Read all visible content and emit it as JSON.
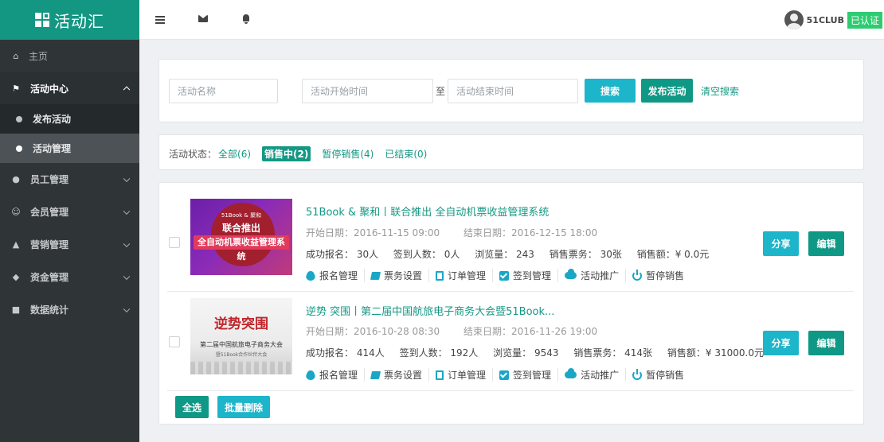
{
  "logo": {
    "text": "活动汇"
  },
  "sidebar": {
    "home": "主页",
    "activity_center": "活动中心",
    "sub": [
      "发布活动",
      "活动管理"
    ],
    "items": [
      "员工管理",
      "会员管理",
      "营销管理",
      "资金管理",
      "数据统计"
    ]
  },
  "header": {
    "username": "51CLUB",
    "verified": "已认证"
  },
  "search": {
    "name_placeholder": "活动名称",
    "start_placeholder": "活动开始时间",
    "to": "至",
    "end_placeholder": "活动结束时间",
    "search_btn": "搜索",
    "publish_btn": "发布活动",
    "clear": "清空搜索"
  },
  "status": {
    "label": "活动状态：",
    "options": [
      "全部(6)",
      "销售中(2)",
      "暂停销售(4)",
      "已结束(0)"
    ]
  },
  "events": [
    {
      "title": "51Book & 聚和丨联合推出 全自动机票收益管理系统",
      "start": "开始日期：2016-11-15 09:00",
      "end": "结束日期：2016-12-15 18:00",
      "signups": "成功报名： 30人",
      "checkins": "签到人数： 0人",
      "views": "浏览量： 243",
      "tickets": "销售票务： 30张",
      "revenue": "销售额：¥ 0.0元",
      "thumb": {
        "line1": "51Book & 聚和",
        "line2": "联合推出",
        "band": "全自动机票收益管理系统"
      }
    },
    {
      "title": "逆势 突围丨第二届中国航旅电子商务大会暨51Book...",
      "start": "开始日期：2016-10-28 08:30",
      "end": "结束日期：2016-11-26 19:00",
      "signups": "成功报名： 414人",
      "checkins": "签到人数： 192人",
      "views": "浏览量： 9543",
      "tickets": "销售票务： 414张",
      "revenue": "销售额：¥ 31000.0元",
      "thumb": {
        "line1": "逆势突围",
        "line2": "第二届中国航旅电子商务大会",
        "line3": "暨51Book合作伙伴大会"
      }
    }
  ],
  "actions": [
    "报名管理",
    "票务设置",
    "订单管理",
    "签到管理",
    "活动推广",
    "暂停销售"
  ],
  "row_buttons": {
    "share": "分享",
    "edit": "编辑"
  },
  "footer": {
    "select_all": "全选",
    "batch_delete": "批量删除"
  },
  "colors": {
    "brand": "#149782",
    "cyan": "#1cb5c9",
    "sidebar": "#2f3437"
  }
}
